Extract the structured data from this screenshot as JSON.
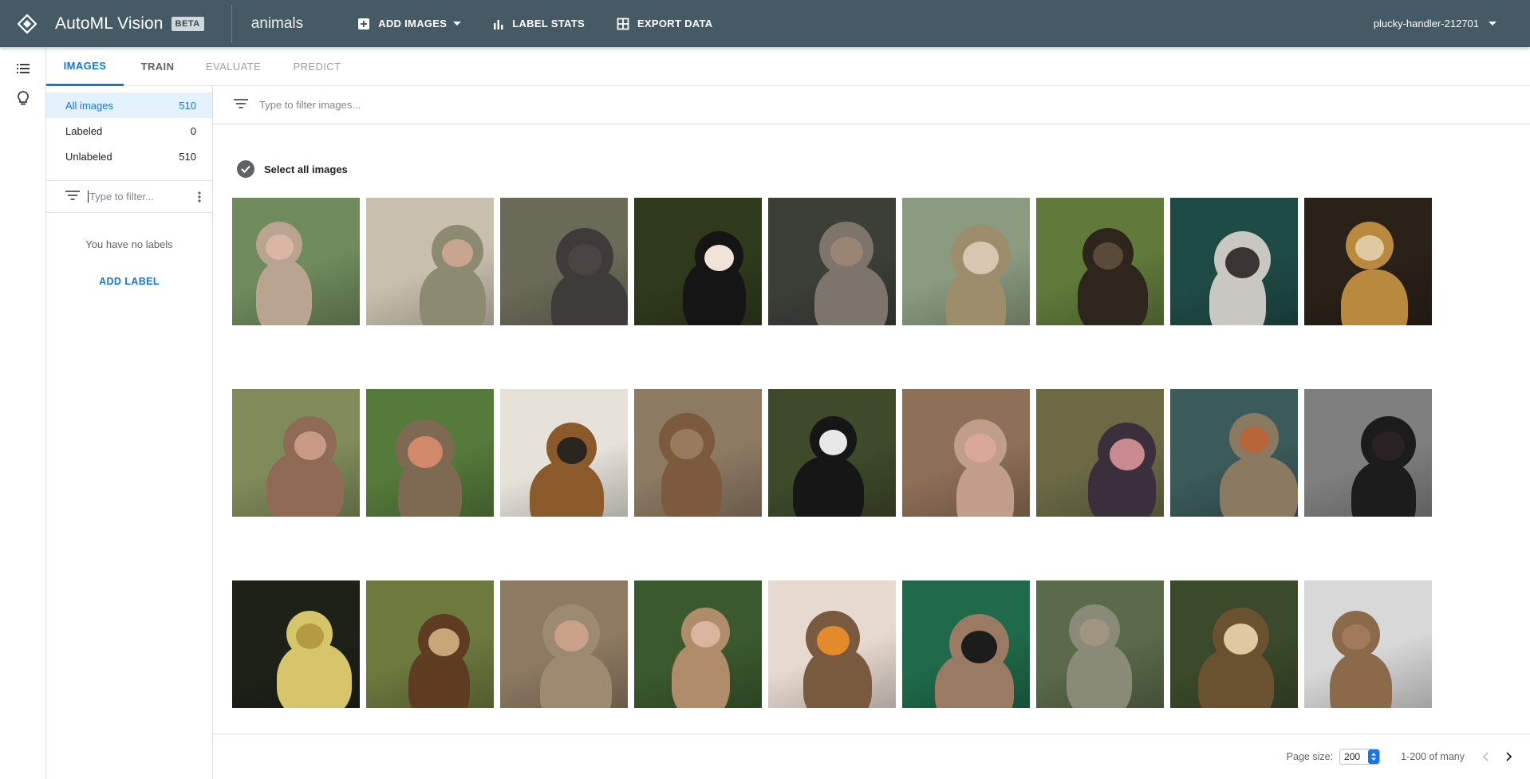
{
  "header": {
    "app_title": "AutoML Vision",
    "badge": "BETA",
    "dataset_name": "animals",
    "add_images": "ADD IMAGES",
    "label_stats": "LABEL STATS",
    "export_data": "EXPORT DATA",
    "project": "plucky-handler-212701"
  },
  "rail": {
    "icons": [
      "list-icon",
      "lightbulb-icon"
    ]
  },
  "tabs": [
    {
      "label": "IMAGES",
      "state": "active"
    },
    {
      "label": "TRAIN",
      "state": "enabled"
    },
    {
      "label": "EVALUATE",
      "state": "disabled"
    },
    {
      "label": "PREDICT",
      "state": "disabled"
    }
  ],
  "sidebar": {
    "filters": [
      {
        "label": "All images",
        "count": "510",
        "selected": true
      },
      {
        "label": "Labeled",
        "count": "0",
        "selected": false
      },
      {
        "label": "Unlabeled",
        "count": "510",
        "selected": false
      }
    ],
    "label_filter_placeholder": "Type to filter...",
    "empty_text": "You have no labels",
    "add_label": "ADD LABEL"
  },
  "main": {
    "search_placeholder": "Type to filter images...",
    "select_all": "Select all images",
    "images": [
      {
        "bg": "#6f8a5c",
        "fur": "#b9a48f",
        "face": "#d9b7a4"
      },
      {
        "bg": "#c8bfae",
        "fur": "#8d8a72",
        "face": "#c9a58f"
      },
      {
        "bg": "#6b6a58",
        "fur": "#3e3c3a",
        "face": "#4a4542"
      },
      {
        "bg": "#2f3a1c",
        "fur": "#151515",
        "face": "#f1e3d8"
      },
      {
        "bg": "#3c3f38",
        "fur": "#7d756b",
        "face": "#9a8574"
      },
      {
        "bg": "#8a9b80",
        "fur": "#9c8e6a",
        "face": "#d8c7b0"
      },
      {
        "bg": "#5f7a3a",
        "fur": "#2e251c",
        "face": "#5a4a3a"
      },
      {
        "bg": "#1f4b45",
        "fur": "#c9c7c2",
        "face": "#3a3532"
      },
      {
        "bg": "#2a2118",
        "fur": "#b9893e",
        "face": "#e0c9a0"
      },
      {
        "bg": "#7f8b5a",
        "fur": "#8f6b55",
        "face": "#c99b86"
      },
      {
        "bg": "#557a3a",
        "fur": "#7e6a52",
        "face": "#d08a6a"
      },
      {
        "bg": "#e6e2da",
        "fur": "#8a5a2b",
        "face": "#2b2520"
      },
      {
        "bg": "#8c7a62",
        "fur": "#7b5a3e",
        "face": "#9a7a5c"
      },
      {
        "bg": "#3e4a2a",
        "fur": "#161616",
        "face": "#e8e8e8"
      },
      {
        "bg": "#8e6f57",
        "fur": "#c09e8b",
        "face": "#d9a89a"
      },
      {
        "bg": "#6b6a45",
        "fur": "#3a2f3a",
        "face": "#c98a90"
      },
      {
        "bg": "#3b5a5a",
        "fur": "#8a7a62",
        "face": "#b9653a"
      },
      {
        "bg": "#7f7f7f",
        "fur": "#1c1c1c",
        "face": "#2a2222"
      },
      {
        "bg": "#1d2118",
        "fur": "#d6c56a",
        "face": "#b49a40"
      },
      {
        "bg": "#6c7a3e",
        "fur": "#5e3c22",
        "face": "#c9a67a"
      },
      {
        "bg": "#8e7a62",
        "fur": "#9e8a70",
        "face": "#c9a088"
      },
      {
        "bg": "#3a5a2e",
        "fur": "#b08c6a",
        "face": "#d9b5a0"
      },
      {
        "bg": "#e6d9cf",
        "fur": "#7a5a3e",
        "face": "#e38a2a"
      },
      {
        "bg": "#1e6a4a",
        "fur": "#9a7a62",
        "face": "#1c1c1c"
      },
      {
        "bg": "#5a6a4a",
        "fur": "#8a8a78",
        "face": "#a09580"
      },
      {
        "bg": "#3b4a2a",
        "fur": "#6a5230",
        "face": "#e0c9a0"
      },
      {
        "bg": "#d8d8d8",
        "fur": "#8a6a4a",
        "face": "#a07a5a"
      }
    ]
  },
  "pagination": {
    "page_size_label": "Page size:",
    "page_size": "200",
    "range": "1-200 of many"
  },
  "colors": {
    "topbar": "#455a64",
    "accent": "#1976d2",
    "selected_bg": "#e3f2fd"
  }
}
